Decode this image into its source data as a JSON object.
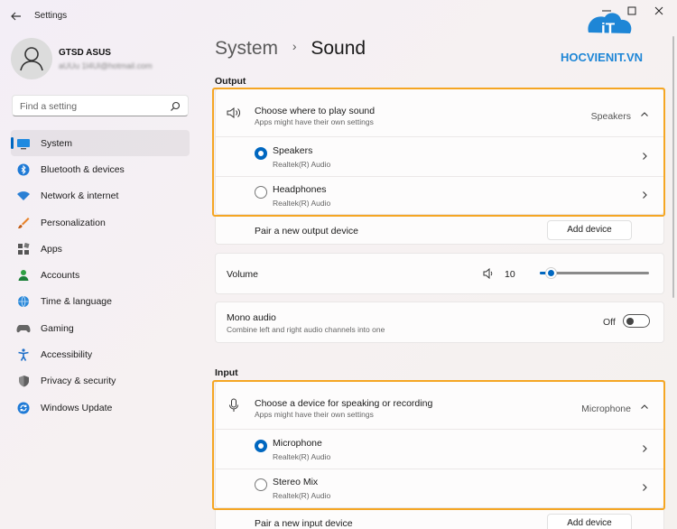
{
  "window": {
    "title": "Settings"
  },
  "user": {
    "name": "GTSD ASUS",
    "email": "aUUu 1l4Ul@hotmail.com"
  },
  "search": {
    "placeholder": "Find a setting"
  },
  "sidebar": {
    "items": [
      {
        "label": "System",
        "icon": "monitor-icon",
        "active": true
      },
      {
        "label": "Bluetooth & devices",
        "icon": "bluetooth-icon"
      },
      {
        "label": "Network & internet",
        "icon": "wifi-icon"
      },
      {
        "label": "Personalization",
        "icon": "brush-icon"
      },
      {
        "label": "Apps",
        "icon": "apps-icon"
      },
      {
        "label": "Accounts",
        "icon": "person-icon"
      },
      {
        "label": "Time & language",
        "icon": "globe-clock-icon"
      },
      {
        "label": "Gaming",
        "icon": "gamepad-icon"
      },
      {
        "label": "Accessibility",
        "icon": "accessibility-icon"
      },
      {
        "label": "Privacy & security",
        "icon": "shield-icon"
      },
      {
        "label": "Windows Update",
        "icon": "update-icon"
      }
    ]
  },
  "breadcrumb": {
    "parent": "System",
    "separator": "›",
    "current": "Sound"
  },
  "logo": {
    "text": "HOCVIENIT.VN",
    "mark": "iT"
  },
  "output": {
    "section_title": "Output",
    "choose_title": "Choose where to play sound",
    "choose_sub": "Apps might have their own settings",
    "selected": "Speakers",
    "devices": [
      {
        "name": "Speakers",
        "driver": "Realtek(R) Audio",
        "selected": true
      },
      {
        "name": "Headphones",
        "driver": "Realtek(R) Audio",
        "selected": false
      }
    ],
    "pair_label": "Pair a new output device",
    "add_button": "Add device"
  },
  "volume": {
    "label": "Volume",
    "value": "10",
    "level": 0.1
  },
  "mono": {
    "title": "Mono audio",
    "sub": "Combine left and right audio channels into one",
    "state": "Off"
  },
  "input": {
    "section_title": "Input",
    "choose_title": "Choose a device for speaking or recording",
    "choose_sub": "Apps might have their own settings",
    "selected": "Microphone",
    "devices": [
      {
        "name": "Microphone",
        "driver": "Realtek(R) Audio",
        "selected": true
      },
      {
        "name": "Stereo Mix",
        "driver": "Realtek(R) Audio",
        "selected": false
      }
    ],
    "pair_label": "Pair a new input device",
    "add_button": "Add device"
  },
  "colors": {
    "accent": "#0067c0",
    "highlight": "#f5a623"
  }
}
